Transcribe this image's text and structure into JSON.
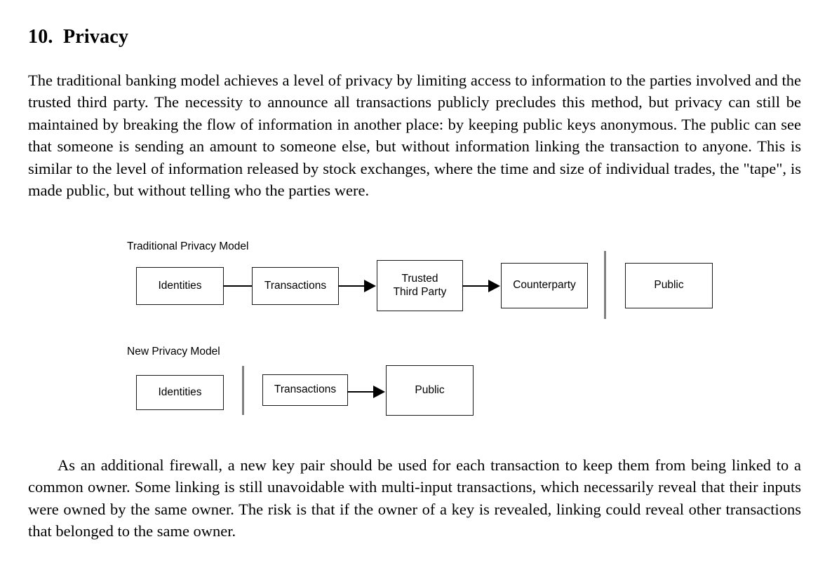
{
  "document": {
    "section_number": "10.",
    "section_title": "Privacy",
    "heading": "10.  Privacy",
    "paragraphs": [
      "The traditional banking model achieves a level of privacy by limiting access to information to the parties involved and the trusted third party.  The necessity to announce all transactions publicly precludes this method, but privacy can still be maintained by breaking the flow of information in another place: by keeping public keys anonymous.  The public can see that someone is sending an amount to someone else, but without information linking the transaction to anyone.  This is similar to the level of information released by stock exchanges, where the time and size of individual trades, the \"tape\", is made public, but without telling who the parties were.",
      "As an additional firewall, a new key pair should be used for each transaction to keep them from being linked to a common owner.  Some linking is still unavoidable with multi-input transactions, which necessarily reveal that their inputs were owned by the same owner.  The risk is that if the owner of a key is revealed, linking could reveal other transactions that belonged to the same owner."
    ]
  },
  "figure": {
    "colors": {
      "node_border": "#1a1a1a",
      "node_fill": "#ffffff",
      "connector": "#000000",
      "privacy_divider": "#808080",
      "text": "#000000"
    },
    "diagrams": [
      {
        "label": "Traditional Privacy Model",
        "nodes": [
          {
            "id": "identities",
            "text": "Identities"
          },
          {
            "id": "transactions",
            "text": "Transactions"
          },
          {
            "id": "trusted-third-party",
            "text": "Trusted\nThird Party"
          },
          {
            "id": "counterparty",
            "text": "Counterparty"
          },
          {
            "id": "public",
            "text": "Public"
          }
        ],
        "connections": [
          {
            "from": "identities",
            "to": "transactions",
            "arrow": false
          },
          {
            "from": "transactions",
            "to": "trusted-third-party",
            "arrow": true
          },
          {
            "from": "trusted-third-party",
            "to": "counterparty",
            "arrow": true
          }
        ],
        "divider_after": "counterparty"
      },
      {
        "label": "New Privacy Model",
        "nodes": [
          {
            "id": "identities",
            "text": "Identities"
          },
          {
            "id": "transactions",
            "text": "Transactions"
          },
          {
            "id": "public",
            "text": "Public"
          }
        ],
        "connections": [
          {
            "from": "transactions",
            "to": "public",
            "arrow": true
          }
        ],
        "divider_after": "identities"
      }
    ]
  }
}
